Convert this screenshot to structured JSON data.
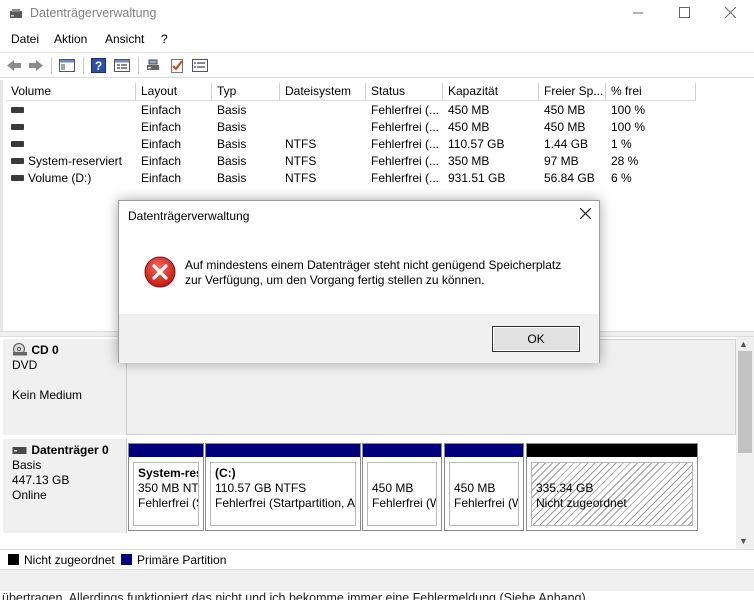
{
  "window": {
    "title": "Datenträgerverwaltung"
  },
  "menu": [
    "Datei",
    "Aktion",
    "Ansicht",
    "?"
  ],
  "table": {
    "headers": [
      "Volume",
      "Layout",
      "Typ",
      "Dateisystem",
      "Status",
      "Kapazität",
      "Freier Sp...",
      "% frei"
    ],
    "rows": [
      [
        "",
        "Einfach",
        "Basis",
        "",
        "Fehlerfrei (...",
        "450 MB",
        "450 MB",
        "100 %"
      ],
      [
        "",
        "Einfach",
        "Basis",
        "",
        "Fehlerfrei (...",
        "450 MB",
        "450 MB",
        "100 %"
      ],
      [
        "",
        "Einfach",
        "Basis",
        "NTFS",
        "Fehlerfrei (...",
        "110.57 GB",
        "1.44 GB",
        "1 %"
      ],
      [
        "System-reserviert",
        "Einfach",
        "Basis",
        "NTFS",
        "Fehlerfrei (...",
        "350 MB",
        "97 MB",
        "28 %"
      ],
      [
        "Volume (D:)",
        "Einfach",
        "Basis",
        "NTFS",
        "Fehlerfrei (...",
        "931.51 GB",
        "56.84 GB",
        "6 %"
      ]
    ]
  },
  "cd": {
    "name": "CD 0",
    "type": "DVD",
    "state": "Kein Medium"
  },
  "disk0": {
    "name": "Datenträger 0",
    "type": "Basis",
    "size": "447.13 GB",
    "state": "Online",
    "partitions": [
      {
        "line1": "System-res",
        "line2": "350 MB NTF",
        "line3": "Fehlerfrei (S",
        "band": "#00007f"
      },
      {
        "line1": "(C:)",
        "line2": "110.57 GB NTFS",
        "line3": "Fehlerfrei (Startpartition, A",
        "band": "#00007f"
      },
      {
        "line1": "",
        "line2": "450 MB",
        "line3": "Fehlerfrei (W",
        "band": "#00007f"
      },
      {
        "line1": "",
        "line2": "450 MB",
        "line3": "Fehlerfrei (W",
        "band": "#00007f"
      },
      {
        "line1": "",
        "line2": "335.34 GB",
        "line3": "Nicht zugeordnet",
        "band": "#000000"
      }
    ]
  },
  "legend": {
    "unallocated": "Nicht zugeordnet",
    "primary": "Primäre Partition",
    "unallocated_color": "#000000",
    "primary_color": "#00007f"
  },
  "dialog": {
    "title": "Datenträgerverwaltung",
    "message_line1": "Auf mindestens einem Datenträger steht nicht genügend Speicherplatz",
    "message_line2": "zur Verfügung, um den Vorgang fertig stellen zu können.",
    "ok_label": "OK",
    "icon": "error-icon"
  },
  "background_text": "übertragen. Allerdings funktioniert das nicht und ich bekomme immer eine Fehlermeldung (Siehe Anhang)."
}
